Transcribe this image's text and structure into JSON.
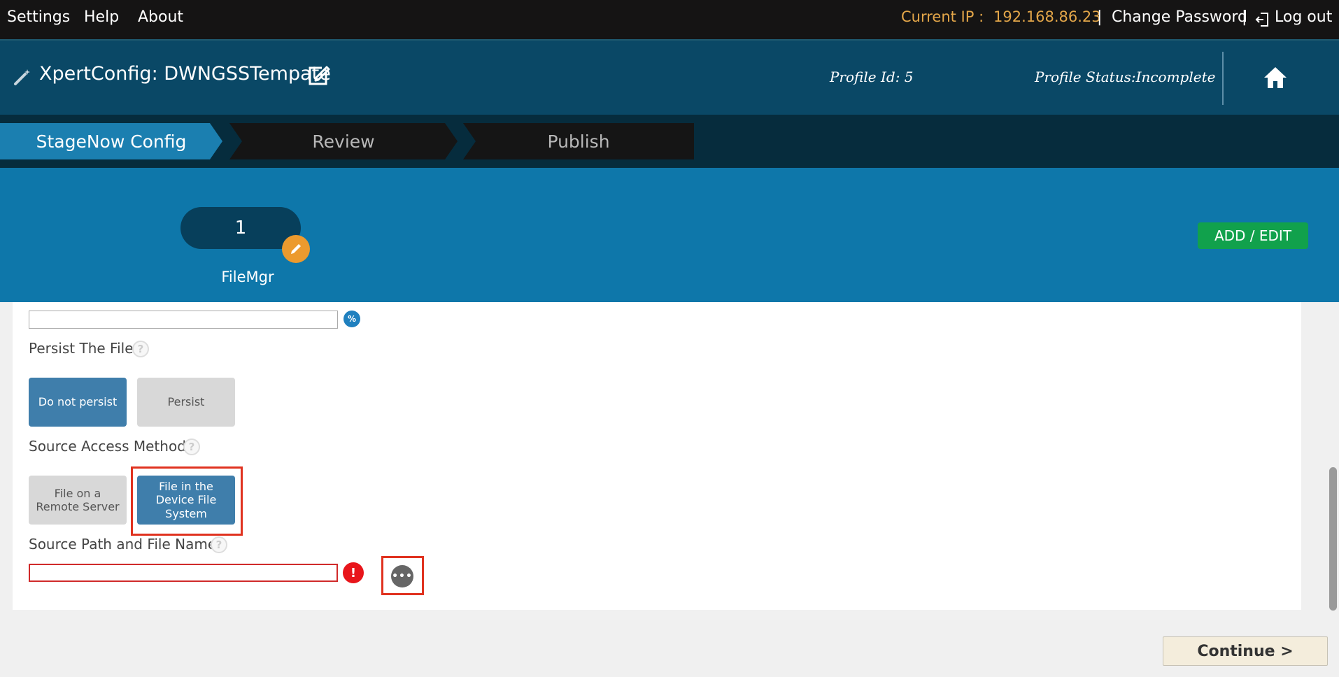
{
  "topbar": {
    "menu": [
      "Settings",
      "Help",
      "About"
    ],
    "ip_label": "Current IP :",
    "ip_value": "192.168.86.23",
    "separator": "|",
    "change_password": "Change Password",
    "logout": "Log out"
  },
  "header": {
    "title": "XpertConfig: DWNGSSTempate",
    "profile_id": "Profile Id: 5",
    "profile_status": "Profile Status:Incomplete"
  },
  "steps": [
    {
      "label": "StageNow Config",
      "state": "active"
    },
    {
      "label": "Review",
      "state": "inactive"
    },
    {
      "label": "Publish",
      "state": "inactive"
    }
  ],
  "panel": {
    "step_count": "1",
    "step_caption": "FileMgr",
    "add_edit_label": "ADD / EDIT"
  },
  "form": {
    "top_input_value": "",
    "persist_label": "Persist The File:",
    "persist_options": [
      "Do not persist",
      "Persist"
    ],
    "persist_selected": "Do not persist",
    "source_access_label": "Source Access Method:",
    "source_access_options": [
      "File on a Remote Server",
      "File in the Device File System"
    ],
    "source_access_selected": "File in the Device File System",
    "source_path_label": "Source Path and File Name:",
    "source_path_value": "",
    "help_glyph": "?",
    "error_glyph": "!",
    "more_glyph": "•••",
    "percent_glyph": "%"
  },
  "footer": {
    "continue_label": "Continue   >"
  },
  "colors": {
    "accent": "#0e77aa",
    "selected_option": "#3f7eab",
    "highlight_border": "#e0321f",
    "ip_text": "#e3a649",
    "add_edit": "#11a14c"
  },
  "icons": {
    "wand": "magic-wand-icon",
    "edit": "edit-square-icon",
    "home": "home-icon",
    "logout": "logout-icon",
    "pencil": "pencil-icon",
    "help": "help-icon",
    "error": "error-icon",
    "browse": "ellipsis-icon",
    "variable": "percent-icon"
  }
}
